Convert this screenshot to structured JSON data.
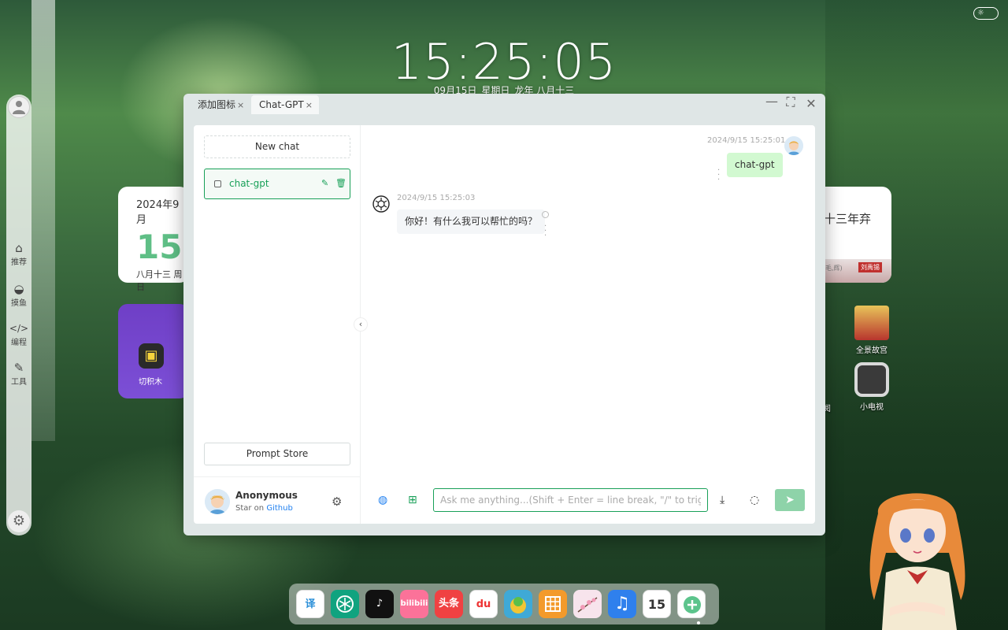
{
  "desktop": {
    "time": "15:25:05",
    "date": "09月15日",
    "weekday": "星期日",
    "lunar": "龙年 八月十三"
  },
  "sidebar": {
    "items": [
      {
        "label": "推荐",
        "icon": "home-icon"
      },
      {
        "label": "摸鱼",
        "icon": "gamepad-icon"
      },
      {
        "label": "编程",
        "icon": "code-icon"
      },
      {
        "label": "工具",
        "icon": "wrench-icon"
      }
    ]
  },
  "widgets": {
    "calendar": {
      "year_month": "2024年9月",
      "day": "15",
      "lunar": "八月十三 周日"
    },
    "app": {
      "label": "切积木"
    },
    "right_text": "十三年弃",
    "right_small": "毛,辉)",
    "right_stamp": "刘禹锡"
  },
  "desktop_icons": [
    {
      "label": "全景故宫"
    },
    {
      "label": "小电视"
    },
    {
      "label": "阅"
    }
  ],
  "window": {
    "tabs": [
      {
        "label": "添加图标",
        "close": "×"
      },
      {
        "label": "Chat-GPT",
        "close": "×"
      }
    ]
  },
  "chat": {
    "new_chat_label": "New chat",
    "session_title": "chat-gpt",
    "prompt_store_label": "Prompt Store",
    "user": {
      "name": "Anonymous",
      "sub_prefix": "Star on",
      "sub_link": "Github"
    },
    "messages": [
      {
        "role": "user",
        "time": "2024/9/15 15:25:01",
        "text": "chat-gpt"
      },
      {
        "role": "assistant",
        "time": "2024/9/15 15:25:03",
        "text": "你好！有什么我可以帮忙的吗？"
      }
    ],
    "input_placeholder": "Ask me anything...(Shift + Enter = line break, \"/\" to trigger"
  },
  "dock": {
    "apps": [
      {
        "icon": "translate-icon",
        "label": "译",
        "color": "#ffffff"
      },
      {
        "icon": "chatgpt-icon",
        "label": "",
        "color": "#10a37f"
      },
      {
        "icon": "tiktok-icon",
        "label": "",
        "color": "#111111"
      },
      {
        "icon": "bilibili-icon",
        "label": "bilibili",
        "color": "#fb7299"
      },
      {
        "icon": "toutiao-icon",
        "label": "头条",
        "color": "#f04142"
      },
      {
        "icon": "baidu-map-icon",
        "label": "du",
        "color": "#ffffff"
      },
      {
        "icon": "game-icon",
        "label": "",
        "color": "#3fa9d6"
      },
      {
        "icon": "sudoku-icon",
        "label": "",
        "color": "#f39a2b"
      },
      {
        "icon": "sakura-icon",
        "label": "",
        "color": "#f7e4ec"
      },
      {
        "icon": "music-icon",
        "label": "♫",
        "color": "#2f80ed"
      },
      {
        "icon": "calendar-icon",
        "label": "15",
        "color": "#ffffff"
      },
      {
        "icon": "add-icon",
        "label": "+",
        "color": "#ffffff"
      }
    ]
  },
  "colors": {
    "accent": "#18a058",
    "user_bubble": "#d2f9d1",
    "link": "#2080f0"
  }
}
